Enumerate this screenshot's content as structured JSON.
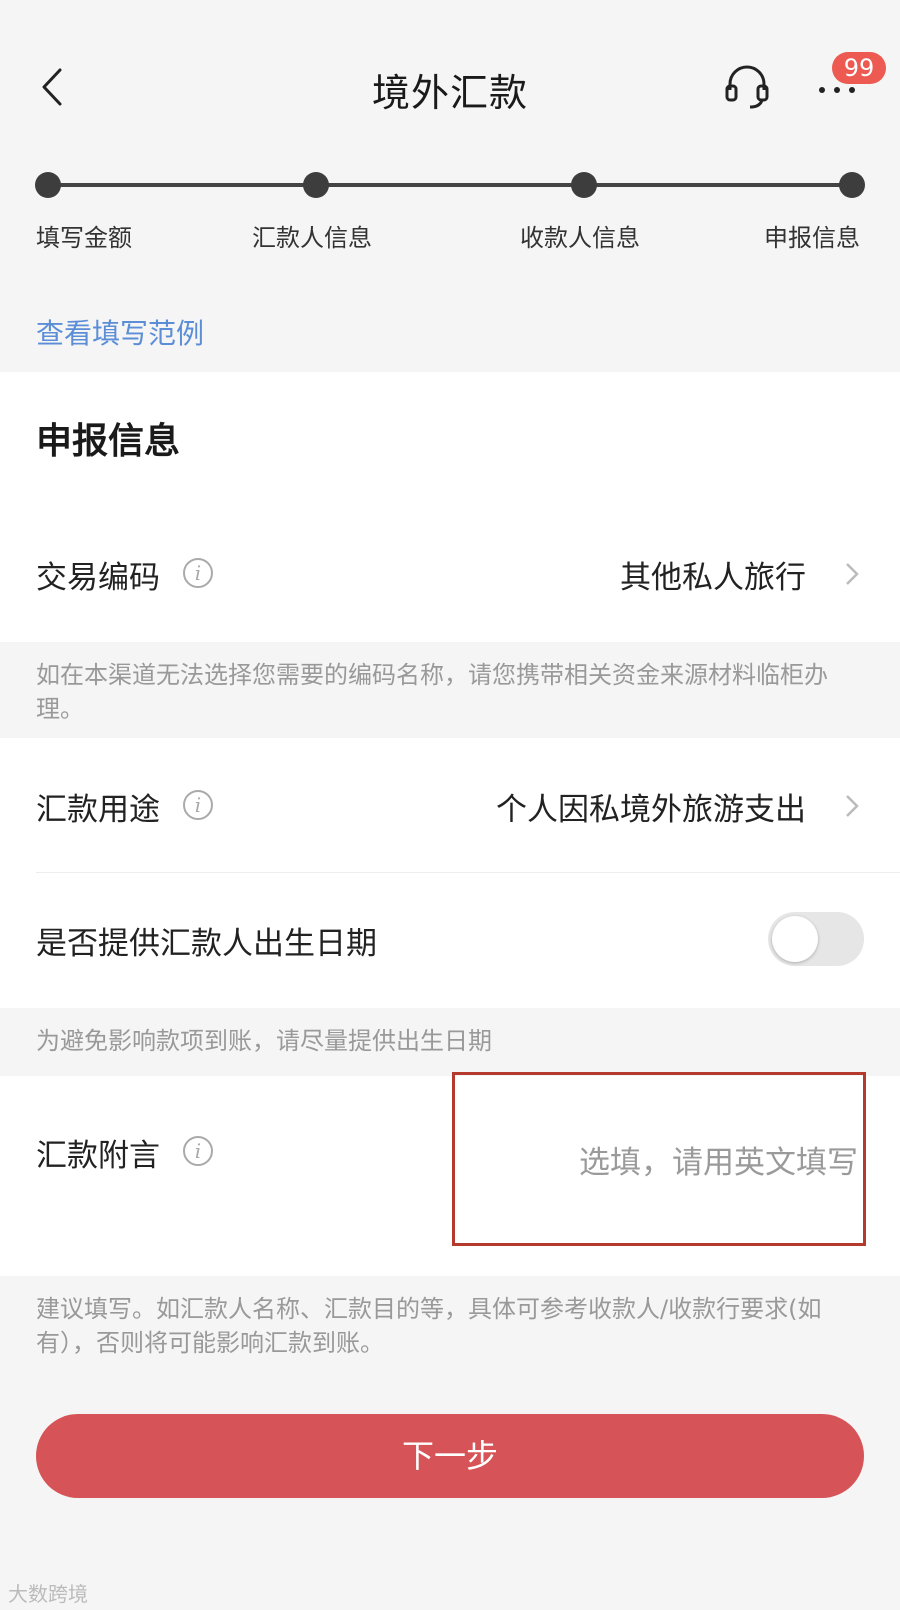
{
  "navbar": {
    "title": "境外汇款",
    "badge_count": "99",
    "back_icon": "chevron-left-icon",
    "service_icon": "headset-icon",
    "more_icon": "more-dots-icon"
  },
  "stepper": {
    "steps": [
      {
        "label": "填写金额"
      },
      {
        "label": "汇款人信息"
      },
      {
        "label": "收款人信息"
      },
      {
        "label": "申报信息"
      }
    ]
  },
  "example_link": "查看填写范例",
  "section": {
    "title": "申报信息"
  },
  "fields": {
    "transaction_code": {
      "label": "交易编码",
      "value": "其他私人旅行"
    },
    "transaction_hint": "如在本渠道无法选择您需要的编码名称，请您携带相关资金来源材料临柜办理。",
    "purpose": {
      "label": "汇款用途",
      "value": "个人因私境外旅游支出"
    },
    "birthdate": {
      "label": "是否提供汇款人出生日期",
      "enabled": false
    },
    "birthdate_hint": "为避免影响款项到账，请尽量提供出生日期",
    "remark": {
      "label": "汇款附言",
      "placeholder": "选填，请用英文填写",
      "value": ""
    },
    "remark_hint": "建议填写。如汇款人名称、汇款目的等，具体可参考收款人/收款行要求(如有），否则将可能影响汇款到账。"
  },
  "next_button": "下一步",
  "watermark": "大数跨境",
  "colors": {
    "primary_button": "#d65457",
    "link": "#5b8ed6",
    "badge": "#ec5a52",
    "highlight": "#b33a2c"
  }
}
